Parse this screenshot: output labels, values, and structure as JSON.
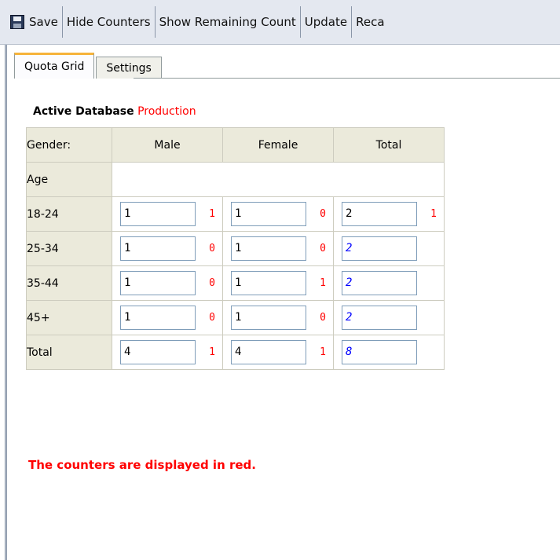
{
  "toolbar": {
    "items": [
      "Save",
      "Hide Counters",
      "Show Remaining Count",
      "Update",
      "Reca"
    ]
  },
  "tabs": [
    "Quota Grid",
    "Settings"
  ],
  "active_db": {
    "label": "Active Database",
    "value": "Production"
  },
  "grid": {
    "corner": "Gender:",
    "columns": [
      "Male",
      "Female",
      "Total"
    ],
    "age_label": "Age",
    "rows": [
      {
        "label": "18-24",
        "male": "1",
        "male_count": "1",
        "female": "1",
        "female_count": "0",
        "total": "2",
        "total_count": "1"
      },
      {
        "label": "25-34",
        "male": "1",
        "male_count": "0",
        "female": "1",
        "female_count": "0",
        "total": "2",
        "total_count": ""
      },
      {
        "label": "35-44",
        "male": "1",
        "male_count": "0",
        "female": "1",
        "female_count": "1",
        "total": "2",
        "total_count": ""
      },
      {
        "label": "45+",
        "male": "1",
        "male_count": "0",
        "female": "1",
        "female_count": "0",
        "total": "2",
        "total_count": ""
      },
      {
        "label": "Total",
        "male": "4",
        "male_count": "1",
        "female": "4",
        "female_count": "1",
        "total": "8",
        "total_count": ""
      }
    ]
  },
  "note": "The counters are displayed in red.",
  "colors": {
    "counter": "#ff0000",
    "calculated": "#0000ff",
    "header_bg": "#ebeadb",
    "tab_accent": "#f6b33b"
  }
}
